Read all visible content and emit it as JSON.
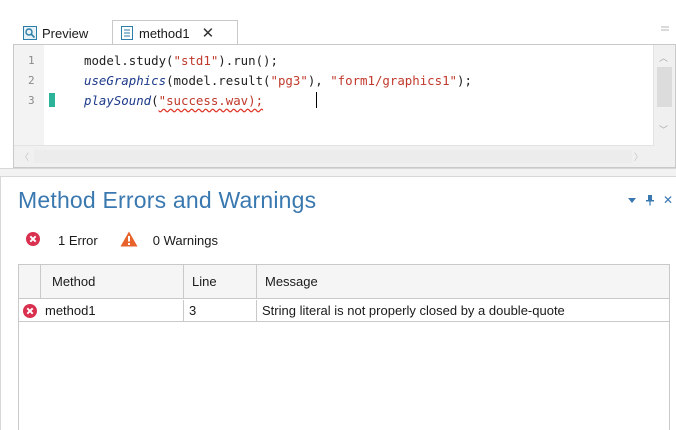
{
  "tabs": [
    {
      "label": "Preview",
      "icon": "preview-icon",
      "active": false
    },
    {
      "label": "method1",
      "icon": "method-file-icon",
      "active": true
    }
  ],
  "editor": {
    "line_numbers": [
      "1",
      "2",
      "3"
    ],
    "lines": [
      [
        {
          "t": "model.study(",
          "c": "plain"
        },
        {
          "t": "\"std1\"",
          "c": "str"
        },
        {
          "t": ").run();",
          "c": "plain"
        }
      ],
      [
        {
          "t": "useGraphics",
          "c": "fn"
        },
        {
          "t": "(model.result(",
          "c": "plain"
        },
        {
          "t": "\"pg3\"",
          "c": "str"
        },
        {
          "t": "), ",
          "c": "plain"
        },
        {
          "t": "\"form1/graphics1\"",
          "c": "str"
        },
        {
          "t": ");",
          "c": "plain"
        }
      ],
      [
        {
          "t": "playSound",
          "c": "fn"
        },
        {
          "t": "(",
          "c": "plain"
        },
        {
          "t": "\"success.wav);",
          "c": "str err"
        }
      ]
    ]
  },
  "panel": {
    "title": "Method Errors and Warnings",
    "error_count": "1 Error",
    "warning_count": "0 Warnings",
    "columns": {
      "method": "Method",
      "line": "Line",
      "message": "Message"
    },
    "rows": [
      {
        "severity": "error",
        "method": "method1",
        "line": "3",
        "message": "String literal is not properly closed by a double-quote"
      }
    ]
  },
  "colors": {
    "accent": "#3a78b0",
    "error": "#d9304f",
    "warning": "#e8622c",
    "string": "#c0392b",
    "change_bar": "#2db39a"
  }
}
